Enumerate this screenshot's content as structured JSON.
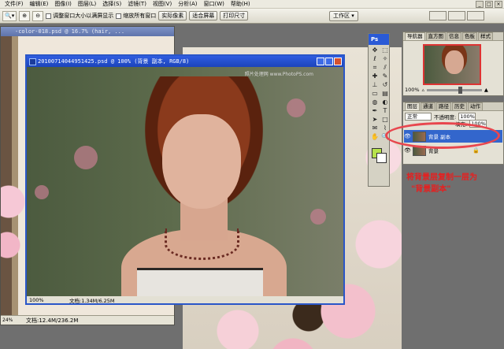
{
  "menubar": {
    "items": [
      "文件(F)",
      "编辑(E)",
      "图像(I)",
      "图层(L)",
      "选择(S)",
      "滤镜(T)",
      "视图(V)",
      "分析(A)",
      "窗口(W)",
      "帮助(H)"
    ]
  },
  "options_bar": {
    "checkbox1": "调整窗口大小以满屏显示",
    "checkbox2": "缩放所有窗口",
    "btn_actual": "实际像素",
    "btn_fit": "适合屏幕",
    "btn_print": "打印尺寸",
    "workspace": "工作区 ▾"
  },
  "doc_left": {
    "title": "-color-018.psd @ 16.7% (hair, ...",
    "zoom": "24%",
    "status": "文档:12.4M/236.2M"
  },
  "doc_main": {
    "title": "20100714044951425.psd @ 100% (背景 副本, RGB/8)",
    "zoom": "100%",
    "status": "文档:1.34M/6.25M",
    "watermark": "照片处理网 www.PhotoPS.com"
  },
  "toolbox": {
    "logo": "Ps"
  },
  "navigator": {
    "tabs": [
      "导航器",
      "直方图",
      "信息",
      "色板",
      "样式"
    ],
    "zoom": "100%"
  },
  "layers_panel": {
    "tabs": [
      "图层",
      "通道",
      "路径",
      "历史",
      "动作"
    ],
    "blend_mode": "正常",
    "opacity_label": "不透明度:",
    "opacity_value": "100%",
    "fill_label": "填充:",
    "fill_value": "100%",
    "layers": [
      {
        "name": "背景 副本",
        "selected": true
      },
      {
        "name": "背景",
        "selected": false
      }
    ]
  },
  "annotation": {
    "line1": "将背景层复制一层为",
    "line2": "\"背景副本\""
  },
  "colors": {
    "foreground": "#b7e24c",
    "background": "#ffffff",
    "highlight": "#e8464e"
  }
}
